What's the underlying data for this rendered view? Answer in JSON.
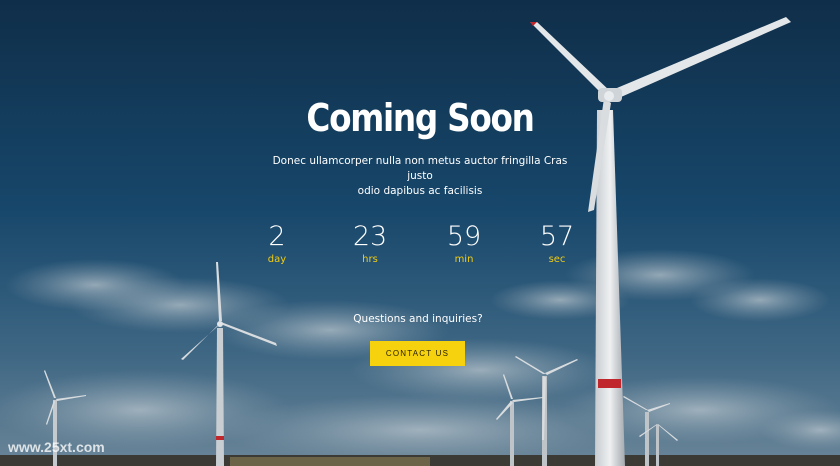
{
  "hero": {
    "title": "Coming Soon",
    "subtitle_line1": "Donec ullamcorper nulla non metus auctor fringilla Cras justo",
    "subtitle_line2": "odio dapibus ac facilisis"
  },
  "countdown": [
    {
      "value": "2",
      "unit": "day"
    },
    {
      "value": "23",
      "unit": "hrs"
    },
    {
      "value": "59",
      "unit": "min"
    },
    {
      "value": "57",
      "unit": "sec"
    }
  ],
  "contact": {
    "question": "Questions and inquiries?",
    "button_label": "CONTACT US"
  },
  "watermark": "www.25xt.com",
  "colors": {
    "accent": "#f5d10e",
    "sky_dark": "#0f3550",
    "text": "#ffffff"
  }
}
